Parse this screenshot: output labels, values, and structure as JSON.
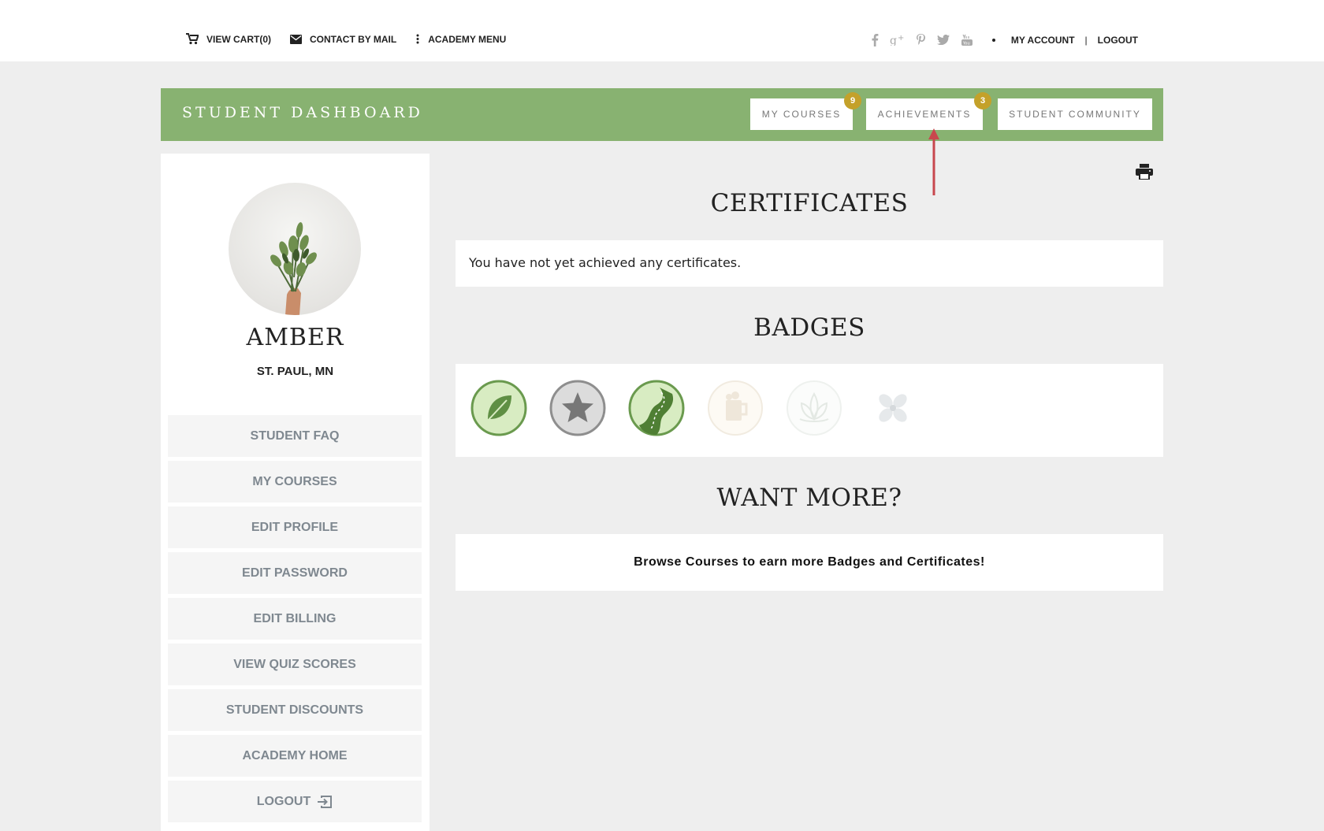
{
  "topbar": {
    "cart": "VIEW CART(0)",
    "contact": "CONTACT BY MAIL",
    "menu": "ACADEMY MENU",
    "social_icons": [
      "facebook-icon",
      "google-plus-icon",
      "pinterest-icon",
      "twitter-icon",
      "youtube-icon"
    ],
    "my_account": "MY ACCOUNT",
    "separator": "|",
    "logout": "LOGOUT"
  },
  "dashboard": {
    "title": "STUDENT DASHBOARD",
    "tabs": [
      {
        "label": "MY COURSES",
        "count": "9"
      },
      {
        "label": "ACHIEVEMENTS",
        "count": "3"
      },
      {
        "label": "STUDENT COMMUNITY"
      }
    ],
    "accent": "#88b271",
    "badge_color": "#c4a12a"
  },
  "profile": {
    "name": "AMBER",
    "location": "ST. PAUL, MN"
  },
  "sidebar": {
    "items": [
      {
        "label": "STUDENT FAQ"
      },
      {
        "label": "MY COURSES"
      },
      {
        "label": "EDIT PROFILE"
      },
      {
        "label": "EDIT PASSWORD"
      },
      {
        "label": "EDIT BILLING"
      },
      {
        "label": "VIEW QUIZ SCORES"
      },
      {
        "label": "STUDENT DISCOUNTS"
      },
      {
        "label": "ACADEMY HOME"
      },
      {
        "label": "LOGOUT"
      }
    ]
  },
  "main": {
    "certificates_heading": "CERTIFICATES",
    "certificates_text": "You have not yet achieved any certificates.",
    "badges_heading": "BADGES",
    "badges": [
      {
        "icon": "leaf-badge-icon",
        "earned": true
      },
      {
        "icon": "star-badge-icon",
        "earned": true
      },
      {
        "icon": "road-badge-icon",
        "earned": true
      },
      {
        "icon": "mug-badge-icon",
        "earned": false
      },
      {
        "icon": "lotus-badge-icon",
        "earned": false
      },
      {
        "icon": "butterfly-badge-icon",
        "earned": false
      }
    ],
    "want_more_heading": "WANT MORE?",
    "want_more_text": "Browse Courses to earn more Badges and Certificates!"
  }
}
